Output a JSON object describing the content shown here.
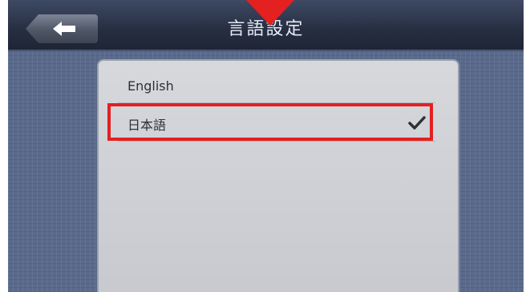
{
  "header": {
    "title": "言語設定",
    "back_icon": "left-arrow-icon"
  },
  "languages": [
    {
      "label": "English",
      "selected": false
    },
    {
      "label": "日本語",
      "selected": true,
      "indicator_icon": "checkmark-icon"
    }
  ],
  "annotation": {
    "highlight_color": "#e42021",
    "arrow_color": "#e42021"
  }
}
